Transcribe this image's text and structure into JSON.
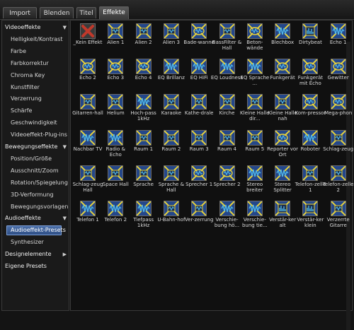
{
  "tabs": [
    "Import",
    "Blenden",
    "Titel",
    "Effekte"
  ],
  "active_tab": "Effekte",
  "sidebar": [
    {
      "label": "Videoeffekte",
      "kind": "cat",
      "arrow": "▼"
    },
    {
      "label": "Helligkeit/Kontrast",
      "kind": "sub"
    },
    {
      "label": "Farbe",
      "kind": "sub"
    },
    {
      "label": "Farbkorrektur",
      "kind": "sub"
    },
    {
      "label": "Chroma Key",
      "kind": "sub"
    },
    {
      "label": "Kunstfilter",
      "kind": "sub"
    },
    {
      "label": "Verzerrung",
      "kind": "sub"
    },
    {
      "label": "Schärfe",
      "kind": "sub"
    },
    {
      "label": "Geschwindigkeit",
      "kind": "sub"
    },
    {
      "label": "Videoeffekt-Plug-ins",
      "kind": "sub"
    },
    {
      "label": "Bewegungseffekte",
      "kind": "cat",
      "arrow": "▼"
    },
    {
      "label": "Position/Größe",
      "kind": "sub"
    },
    {
      "label": "Ausschnitt/Zoom",
      "kind": "sub"
    },
    {
      "label": "Rotation/Spiegelung",
      "kind": "sub"
    },
    {
      "label": "3D-Verformung",
      "kind": "sub"
    },
    {
      "label": "Bewegungsvorlagen",
      "kind": "sub"
    },
    {
      "label": "Audioeffekte",
      "kind": "cat",
      "arrow": "▼"
    },
    {
      "label": "Audioeffekt-Presets",
      "kind": "sub",
      "selected": true
    },
    {
      "label": "Synthesizer",
      "kind": "sub"
    },
    {
      "label": "Designelemente",
      "kind": "cat",
      "arrow": "▶"
    },
    {
      "label": "Eigene Presets",
      "kind": "cat"
    }
  ],
  "effects": [
    {
      "label": "_Kein Effekt",
      "icon": "none-red-x-icon"
    },
    {
      "label": "Alien 1",
      "icon": "effect-burst-icon"
    },
    {
      "label": "Alien 2",
      "icon": "effect-burst-icon"
    },
    {
      "label": "Alien 3",
      "icon": "effect-burst-icon"
    },
    {
      "label": "Bade-wanne",
      "icon": "effect-bubble-icon"
    },
    {
      "label": "BassFilter & Hall",
      "icon": "effect-burst-icon"
    },
    {
      "label": "Beton-wände",
      "icon": "effect-bubble-icon"
    },
    {
      "label": "Blechbox",
      "icon": "effect-wave-icon"
    },
    {
      "label": "Dirtybeat",
      "icon": "effect-bars-icon"
    },
    {
      "label": "Echo 1",
      "icon": "effect-wave-icon"
    },
    {
      "label": "Echo 2",
      "icon": "effect-bubble-icon"
    },
    {
      "label": "Echo 3",
      "icon": "effect-bubble-icon"
    },
    {
      "label": "Echo 4",
      "icon": "effect-bubble-icon"
    },
    {
      "label": "EQ Brillanz",
      "icon": "effect-wave-icon"
    },
    {
      "label": "EQ HiFi",
      "icon": "effect-wave-icon"
    },
    {
      "label": "EQ Loudness",
      "icon": "effect-wave-icon"
    },
    {
      "label": "EQ Sprache ...",
      "icon": "effect-wave-icon"
    },
    {
      "label": "Funkgerät",
      "icon": "effect-bubble-icon"
    },
    {
      "label": "Funkgerät mit Echo",
      "icon": "effect-bubble-icon"
    },
    {
      "label": "Gewitter",
      "icon": "effect-bubble-icon"
    },
    {
      "label": "Gitarren-hall",
      "icon": "effect-burst-icon"
    },
    {
      "label": "Helium",
      "icon": "effect-burst-icon"
    },
    {
      "label": "Hoch-pass 1kHz",
      "icon": "effect-wave-icon"
    },
    {
      "label": "Karaoke",
      "icon": "effect-burst-icon"
    },
    {
      "label": "Kathe-drale",
      "icon": "effect-burst-icon"
    },
    {
      "label": "Kirche",
      "icon": "effect-burst-icon"
    },
    {
      "label": "Kleine Halle dir...",
      "icon": "effect-burst-icon"
    },
    {
      "label": "Kleine Halle nah",
      "icon": "effect-burst-icon"
    },
    {
      "label": "Kom-pressor",
      "icon": "effect-bubble-icon"
    },
    {
      "label": "Mega-phon",
      "icon": "effect-bubble-icon"
    },
    {
      "label": "Nachbar TV",
      "icon": "effect-wave-icon"
    },
    {
      "label": "Radio & Echo",
      "icon": "effect-wave-icon"
    },
    {
      "label": "Raum 1",
      "icon": "effect-burst-icon"
    },
    {
      "label": "Raum 2",
      "icon": "effect-burst-icon"
    },
    {
      "label": "Raum 3",
      "icon": "effect-burst-icon"
    },
    {
      "label": "Raum 4",
      "icon": "effect-burst-icon"
    },
    {
      "label": "Raum 5",
      "icon": "effect-burst-icon"
    },
    {
      "label": "Reporter vor Ort",
      "icon": "effect-bubble-icon"
    },
    {
      "label": "Roboter",
      "icon": "effect-wave-icon"
    },
    {
      "label": "Schlag-zeug",
      "icon": "effect-burst-icon"
    },
    {
      "label": "Schlag-zeug Hall",
      "icon": "effect-burst-icon"
    },
    {
      "label": "Space Hall",
      "icon": "effect-burst-icon"
    },
    {
      "label": "Sprache",
      "icon": "effect-burst-icon"
    },
    {
      "label": "Sprache & Hall",
      "icon": "effect-burst-icon"
    },
    {
      "label": "Sprecher 1",
      "icon": "effect-bubble-icon"
    },
    {
      "label": "Sprecher 2",
      "icon": "effect-bubble-icon"
    },
    {
      "label": "Stereo breiter",
      "icon": "effect-wave-icon"
    },
    {
      "label": "Stereo Splitter",
      "icon": "effect-wave-icon"
    },
    {
      "label": "Telefon-zelle 1",
      "icon": "effect-burst-icon"
    },
    {
      "label": "Telefon-zelle 2",
      "icon": "effect-burst-icon"
    },
    {
      "label": "Telefon 1",
      "icon": "effect-wave-icon"
    },
    {
      "label": "Telefon 2",
      "icon": "effect-wave-icon"
    },
    {
      "label": "Tiefpass 1kHz",
      "icon": "effect-wave-icon"
    },
    {
      "label": "U-Bahn-hof",
      "icon": "effect-burst-icon"
    },
    {
      "label": "Ver-zerrung",
      "icon": "effect-burst-icon"
    },
    {
      "label": "Verschie-bung hö...",
      "icon": "effect-wave-icon"
    },
    {
      "label": "Verschie-bung tie...",
      "icon": "effect-wave-icon"
    },
    {
      "label": "Verstär-ker alt",
      "icon": "effect-bars-icon"
    },
    {
      "label": "Verstär-ker klein",
      "icon": "effect-bars-icon"
    },
    {
      "label": "Verzerrte Gitarre",
      "icon": "effect-burst-icon"
    }
  ],
  "colors": {
    "icon_blue": "#24478a",
    "icon_yellow": "#e8d23a",
    "icon_wave": "#4fb6e8",
    "selection": "#3b5f9a",
    "none_red": "#c0392b"
  }
}
